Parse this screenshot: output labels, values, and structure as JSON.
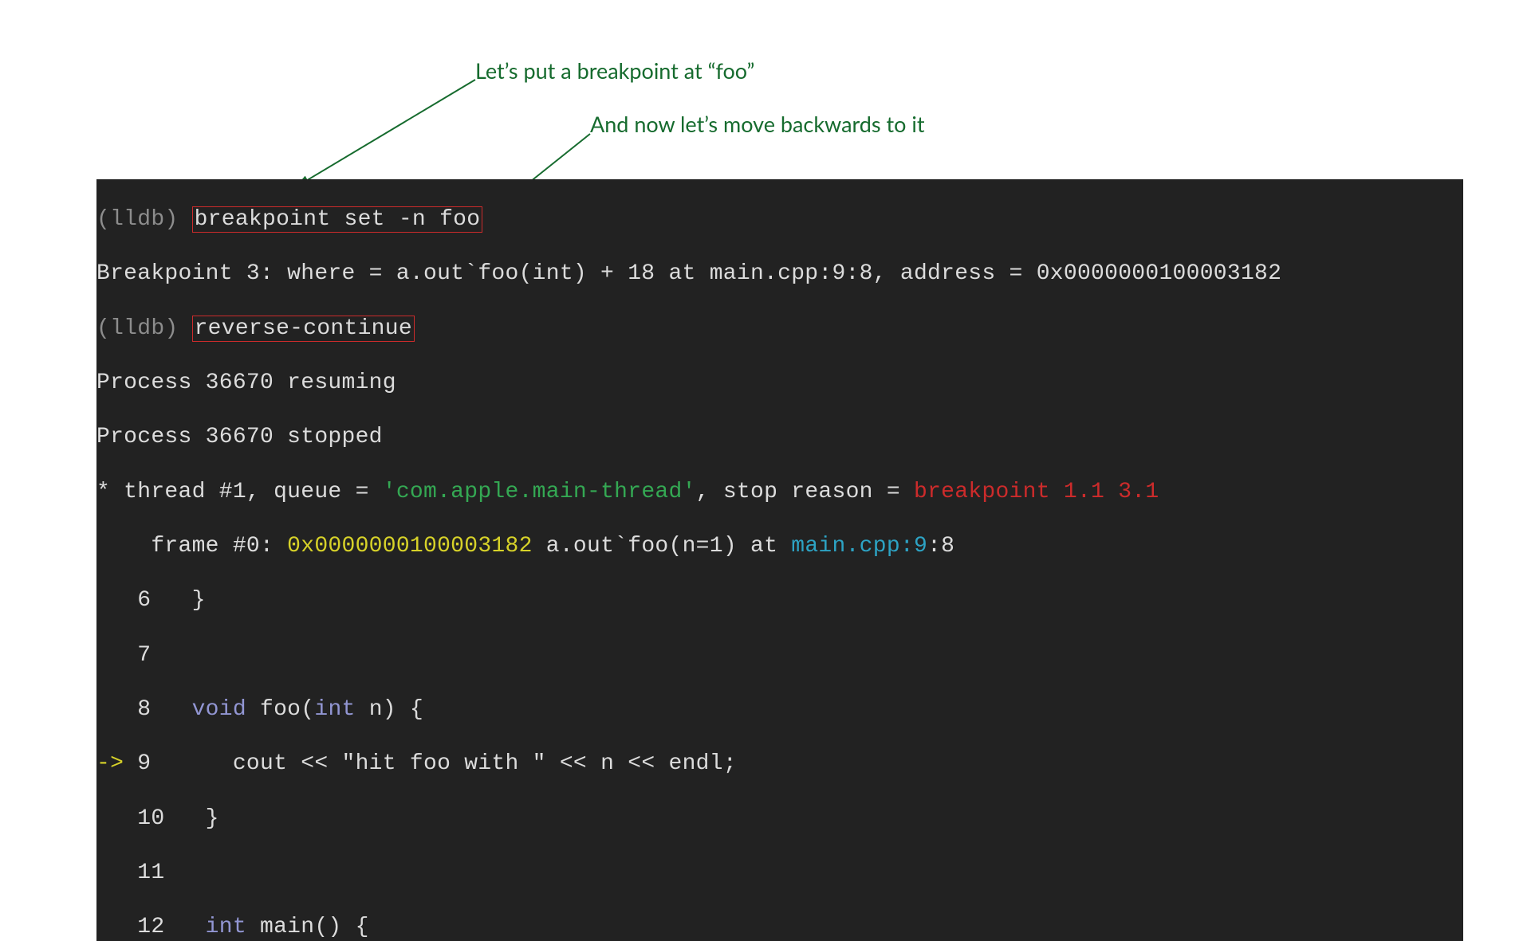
{
  "annotation1": "Let’s put a breakpoint at “foo”",
  "annotation2": "And now let’s move backwards to it",
  "terminal": {
    "prompt": "(lldb)",
    "cmd1": "breakpoint set -n foo",
    "bp_line": "Breakpoint 3: where = a.out`foo(int) + 18 at main.cpp:9:8, address = 0x0000000100003182",
    "cmd2": "reverse-continue",
    "resume": "Process 36670 resuming",
    "stopped": "Process 36670 stopped",
    "thread_prefix": "* thread #1, queue = ",
    "thread_queue": "'com.apple.main-thread'",
    "thread_mid": ", stop reason = ",
    "thread_reason": "breakpoint 1.1 3.1",
    "frame_prefix": "    frame #0: ",
    "frame_addr": "0x0000000100003182",
    "frame_mid": " a.out`foo(n=1) at ",
    "frame_file": "main.cpp:9",
    "frame_tail": ":8",
    "src": {
      "l6_num": "   6",
      "l6_txt": "   }",
      "l7_num": "   7",
      "l7_txt": "",
      "l8_num": "   8",
      "l8_kw": "void",
      "l8_mid": " foo(",
      "l8_kw2": "int",
      "l8_tail": " n) {",
      "l9_arrow": "->",
      "l9_num": " 9",
      "l9_txt": "      cout << \"hit foo with \" << n << endl;",
      "l10_num": "   10",
      "l10_txt": "   }",
      "l11_num": "   11",
      "l11_txt": "",
      "l12_num": "   12",
      "l12_kw": "int",
      "l12_tail": " main() {"
    }
  }
}
